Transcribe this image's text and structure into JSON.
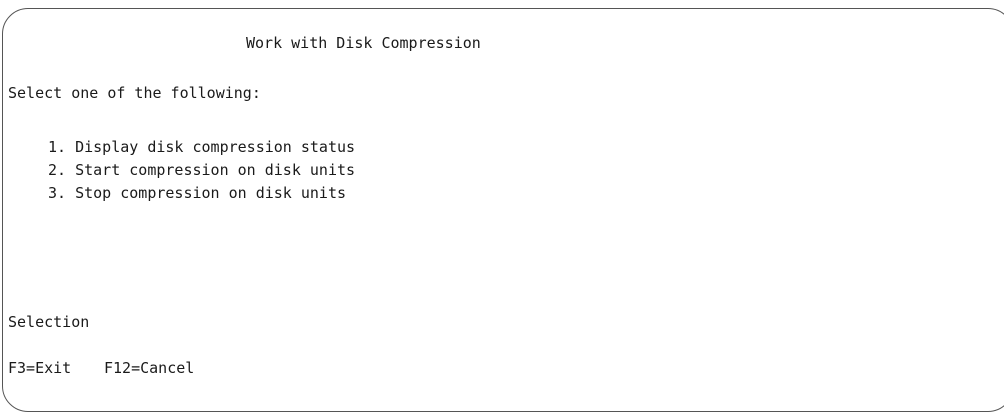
{
  "screen": {
    "title": "Work with Disk Compression",
    "prompt": "Select one of the following:",
    "options": [
      "1. Display disk compression status",
      "2. Start compression on disk units",
      "3. Stop compression on disk units"
    ],
    "selection_label": "Selection",
    "function_keys": [
      "F3=Exit",
      "F12=Cancel"
    ]
  }
}
